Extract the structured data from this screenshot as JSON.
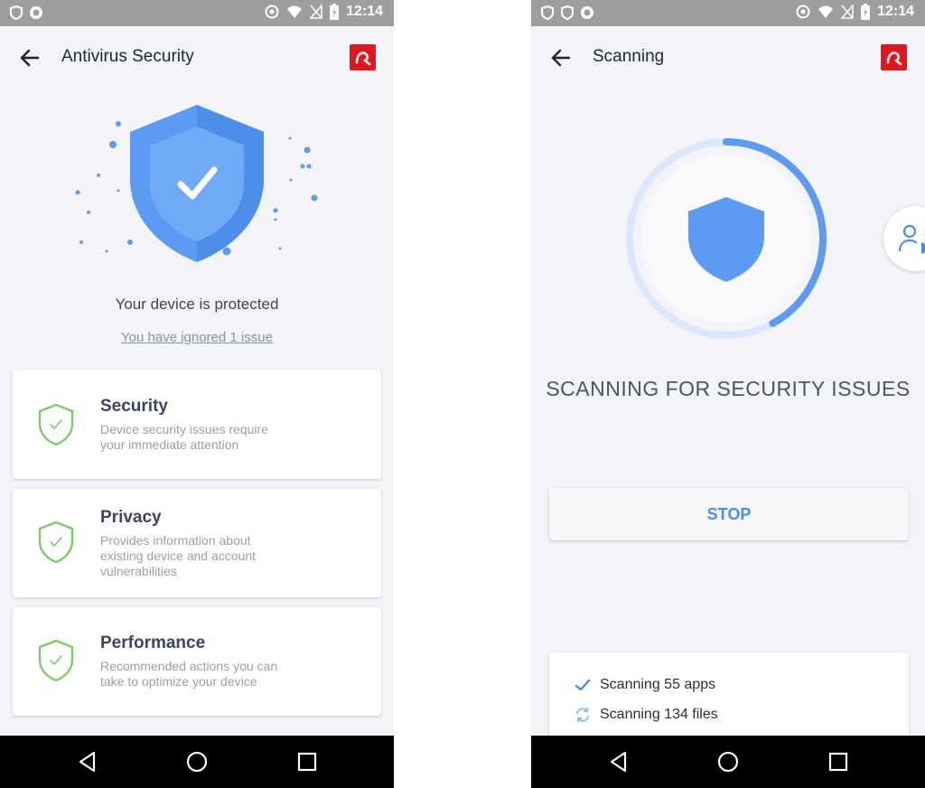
{
  "colors": {
    "accent": "#4b8de8",
    "shield_blue": "#5b9cf2",
    "check_green": "#7ccc6a",
    "brand_red": "#e3161e",
    "status_bar": "#9e9e9e"
  },
  "status_bar": {
    "time": "12:14"
  },
  "left_screen": {
    "title": "Antivirus Security",
    "hero_icon": "shield-check-icon",
    "status_text": "Your device is protected",
    "ignored_link": "You have ignored 1 issue",
    "cards": [
      {
        "title": "Security",
        "description": "Device security issues require your immediate attention",
        "icon": "shield-check-icon"
      },
      {
        "title": "Privacy",
        "description": "Provides information about existing device and account vulnerabilities",
        "icon": "shield-check-icon"
      },
      {
        "title": "Performance",
        "description": "Recommended actions you can take to optimize your device",
        "icon": "shield-check-icon"
      }
    ]
  },
  "right_screen": {
    "title": "Scanning",
    "scan_title": "SCANNING FOR SECURITY ISSUES",
    "scan_progress": 0.42,
    "stop_label": "STOP",
    "progress_items": [
      {
        "text": "Scanning 55 apps",
        "icon": "checkmark-icon",
        "state": "done"
      },
      {
        "text": "Scanning 134 files",
        "icon": "sync-icon",
        "state": "in-progress"
      }
    ],
    "side_action_icon": "user-shield-icon"
  }
}
